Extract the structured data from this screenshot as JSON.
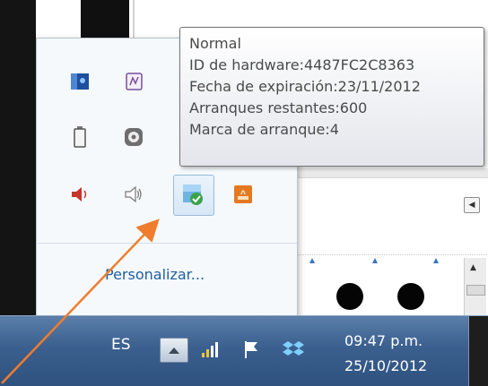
{
  "tooltip": {
    "lines": [
      "Normal",
      "ID de hardware:4487FC2C8363",
      "Fecha de expiración:23/11/2012",
      "Arranques restantes:600",
      "Marca de arranque:4"
    ]
  },
  "overflow": {
    "customize_label": "Personalizar...",
    "icons": [
      "blue-app-icon",
      "notes-app-icon",
      "battery-icon",
      "gear-app-icon",
      "speaker-red-icon",
      "speaker-gray-icon",
      "shield-check-app-icon",
      "orange-app-icon"
    ]
  },
  "taskbar": {
    "language": "ES",
    "time": "09:47 p.m.",
    "date": "25/10/2012",
    "icons": [
      "show-hidden-icon",
      "network-signal-icon",
      "action-center-flag-icon",
      "dropbox-icon"
    ]
  },
  "colors": {
    "taskbar": "#3b5f8e",
    "link": "#1f5e9e",
    "arrow": "#ef7d2e",
    "tooltip_text": "#4a4a4a"
  }
}
